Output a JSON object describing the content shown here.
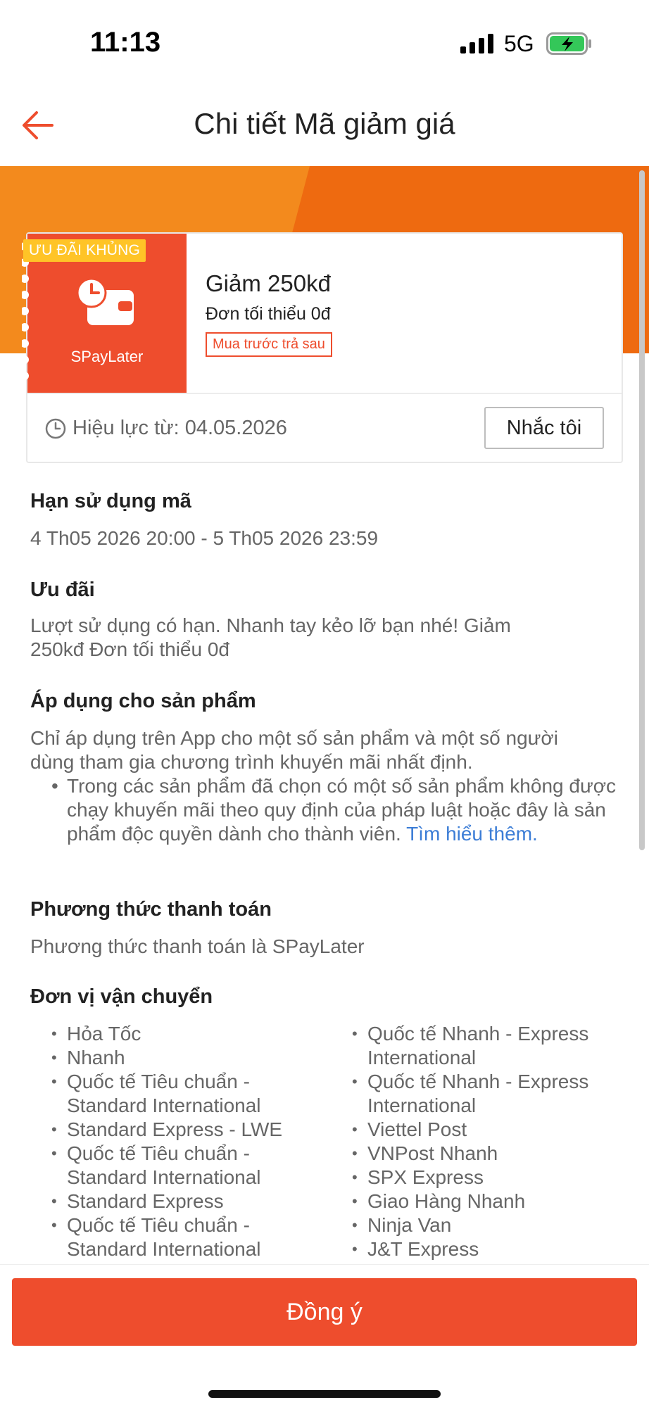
{
  "status_bar": {
    "time": "11:13",
    "network": "5G"
  },
  "header": {
    "title": "Chi tiết Mã giảm giá"
  },
  "voucher": {
    "badge": "ƯU ĐÃI KHỦNG",
    "brand": "SPayLater",
    "title": "Giảm 250kđ",
    "min_order": "Đơn tối thiểu 0đ",
    "tag": "Mua trước trả sau",
    "validity": "Hiệu lực từ: 04.05.2026",
    "remind_label": "Nhắc tôi"
  },
  "sections": {
    "expiry": {
      "title": "Hạn sử dụng mã",
      "text": "4 Th05 2026 20:00 - 5 Th05 2026 23:59"
    },
    "offer": {
      "title": "Ưu đãi",
      "line1": "Lượt sử dụng có hạn. Nhanh tay kẻo lỡ bạn nhé! Giảm",
      "line2": "250kđ Đơn tối thiểu 0đ"
    },
    "products": {
      "title": "Áp dụng cho sản phẩm",
      "line1": "Chỉ áp dụng trên App cho một số sản phẩm và một số người",
      "line2": "dùng tham gia chương trình khuyến mãi nhất định.",
      "bullet": "Trong các sản phẩm đã chọn có một số sản phẩm không được chạy khuyến mãi theo quy định của pháp luật hoặc đây là sản phẩm độc quyền dành cho thành viên.",
      "link": "Tìm hiểu thêm."
    },
    "payment": {
      "title": "Phương thức thanh toán",
      "text": "Phương thức thanh toán là SPayLater"
    },
    "shipping": {
      "title": "Đơn vị vận chuyển",
      "left": [
        "Hỏa Tốc",
        "Nhanh",
        "Quốc tế Tiêu chuẩn - Standard International",
        "Standard Express - LWE",
        "Quốc tế Tiêu chuẩn - Standard International",
        "Standard Express",
        "Quốc tế Tiêu chuẩn - Standard International"
      ],
      "right": [
        "Quốc tế Nhanh - Express International",
        "Quốc tế Nhanh - Express International",
        "Viettel Post",
        "VNPost Nhanh",
        "SPX Express",
        "Giao Hàng Nhanh",
        "Ninja Van",
        "J&T Express"
      ]
    }
  },
  "footer": {
    "agree_label": "Đồng ý"
  },
  "colors": {
    "primary": "#ee4d2d",
    "banner": "#ee6a10",
    "badge": "#ffc427",
    "link": "#3c7dd6"
  }
}
